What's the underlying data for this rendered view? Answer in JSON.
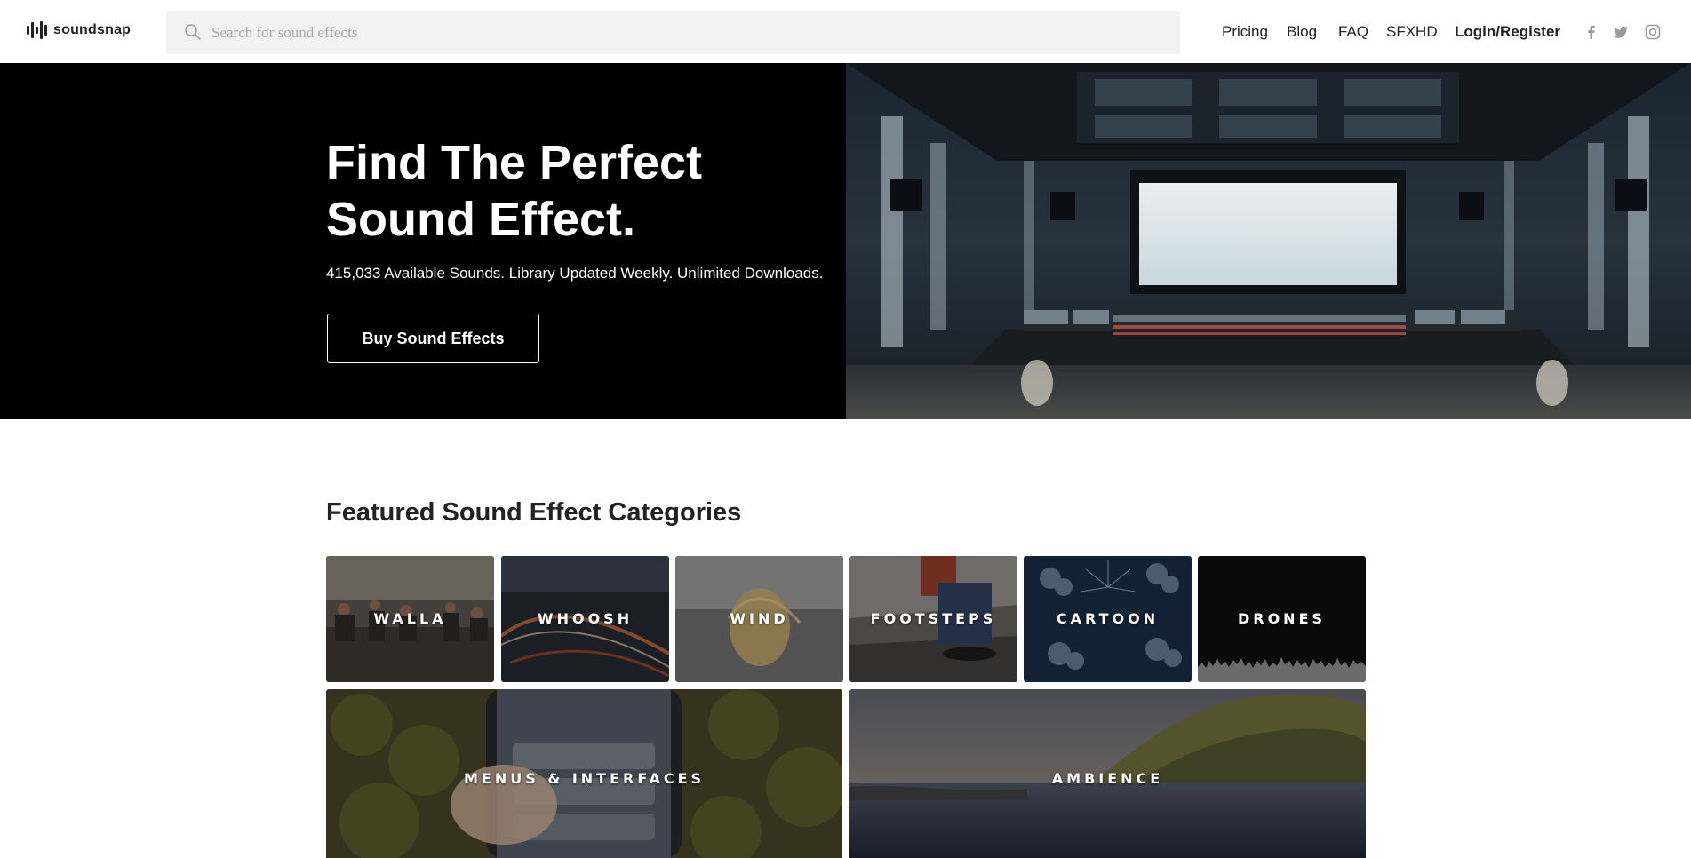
{
  "brand": {
    "name": "soundsnap"
  },
  "search": {
    "placeholder": "Search for sound effects"
  },
  "nav": {
    "pricing": "Pricing",
    "blog": "Blog",
    "faq": "FAQ",
    "sfxhd": "SFXHD",
    "login_register": "Login/Register"
  },
  "social": {
    "icons": [
      "facebook-icon",
      "twitter-icon",
      "instagram-icon"
    ]
  },
  "hero": {
    "title_line1": "Find The Perfect",
    "title_line2": "Sound Effect.",
    "subtitle": "415,033 Available Sounds. Library Updated Weekly. Unlimited Downloads.",
    "cta": "Buy Sound Effects"
  },
  "featured": {
    "title": "Featured Sound Effect Categories",
    "categories": [
      {
        "label": "WALLA"
      },
      {
        "label": "WHOOSH"
      },
      {
        "label": "WIND"
      },
      {
        "label": "FOOTSTEPS"
      },
      {
        "label": "CARTOON"
      },
      {
        "label": "DRONES"
      },
      {
        "label": "MENUS & INTERFACES"
      },
      {
        "label": "AMBIENCE"
      }
    ]
  },
  "colors": {
    "text": "#222222",
    "search_bg": "#f2f2f2",
    "placeholder": "#a8a8a8",
    "hero_bg": "#000000",
    "white": "#ffffff"
  }
}
